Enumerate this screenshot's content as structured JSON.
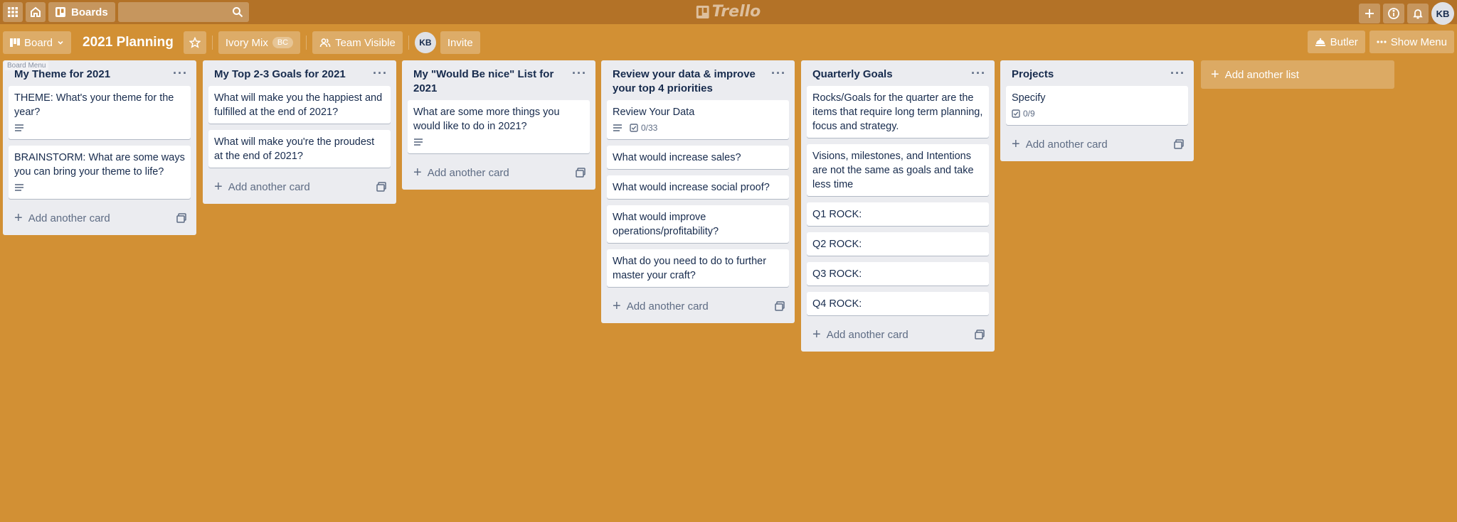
{
  "header": {
    "boards_label": "Boards",
    "logo_text": "Trello",
    "avatar": "KB"
  },
  "board": {
    "view_label": "Board",
    "title": "2021 Planning",
    "workspace": "Ivory Mix",
    "workspace_badge": "BC",
    "visibility": "Team Visible",
    "member": "KB",
    "invite_label": "Invite",
    "butler_label": "Butler",
    "menu_label": "Show Menu",
    "tooltip": "Board Menu"
  },
  "lists": [
    {
      "title": "My Theme for 2021",
      "cards": [
        {
          "text": "THEME: What's your theme for the year?",
          "description": true
        },
        {
          "text": "BRAINSTORM: What are some ways you can bring your theme to life?",
          "description": true
        }
      ],
      "add_card": "Add another card"
    },
    {
      "title": "My Top 2-3 Goals for 2021",
      "cards": [
        {
          "text": "What will make you the happiest and fulfilled at the end of 2021?"
        },
        {
          "text": "What will make you're the proudest at the end of 2021?"
        }
      ],
      "add_card": "Add another card"
    },
    {
      "title": "My \"Would Be nice\" List for 2021",
      "cards": [
        {
          "text": "What are some more things you would like to do in 2021?",
          "description": true
        }
      ],
      "add_card": "Add another card"
    },
    {
      "title": "Review your data & improve your top 4 priorities",
      "cards": [
        {
          "text": "Review Your Data",
          "description": true,
          "checklist": "0/33"
        },
        {
          "text": "What would increase sales?"
        },
        {
          "text": "What would increase social proof?"
        },
        {
          "text": "What would improve operations/profitability?"
        },
        {
          "text": "What do you need to do to further master your craft?"
        }
      ],
      "add_card": "Add another card"
    },
    {
      "title": "Quarterly Goals",
      "cards": [
        {
          "text": "Rocks/Goals for the quarter are the items that require long term planning, focus and strategy."
        },
        {
          "text": "Visions, milestones, and Intentions are not the same as goals and take less time"
        },
        {
          "text": "Q1 ROCK:"
        },
        {
          "text": "Q2 ROCK:"
        },
        {
          "text": "Q3 ROCK:"
        },
        {
          "text": "Q4 ROCK:"
        }
      ],
      "add_card": "Add another card"
    },
    {
      "title": "Projects",
      "cards": [
        {
          "text": "Specify",
          "checklist": "0/9"
        }
      ],
      "add_card": "Add another card"
    }
  ],
  "add_list_label": "Add another list"
}
